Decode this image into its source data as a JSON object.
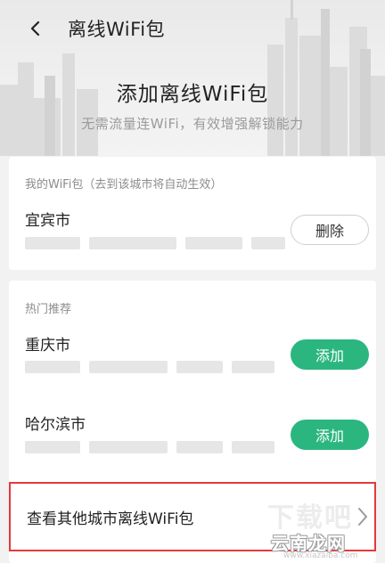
{
  "header": {
    "title": "离线WiFi包"
  },
  "hero": {
    "title": "添加离线WiFi包",
    "subtitle": "无需流量连WiFi，有效增强解锁能力"
  },
  "my_packages": {
    "label": "我的WiFi包（去到该城市将自动生效）",
    "items": [
      {
        "city": "宜宾市",
        "action": "删除"
      }
    ]
  },
  "recommend": {
    "label": "热门推荐",
    "items": [
      {
        "city": "重庆市",
        "action": "添加"
      },
      {
        "city": "哈尔滨市",
        "action": "添加"
      }
    ]
  },
  "more_link": {
    "label": "查看其他城市离线WiFi包"
  },
  "watermark": {
    "site": "云南龙网",
    "ghost": "下载吧",
    "url": "www.xiazaiba.com"
  },
  "colors": {
    "accent": "#2bb680",
    "highlight_border": "#e33a3a",
    "background": "#f2f2f2"
  },
  "icons": {
    "back": "chevron-left-icon",
    "more": "chevron-right-icon"
  }
}
